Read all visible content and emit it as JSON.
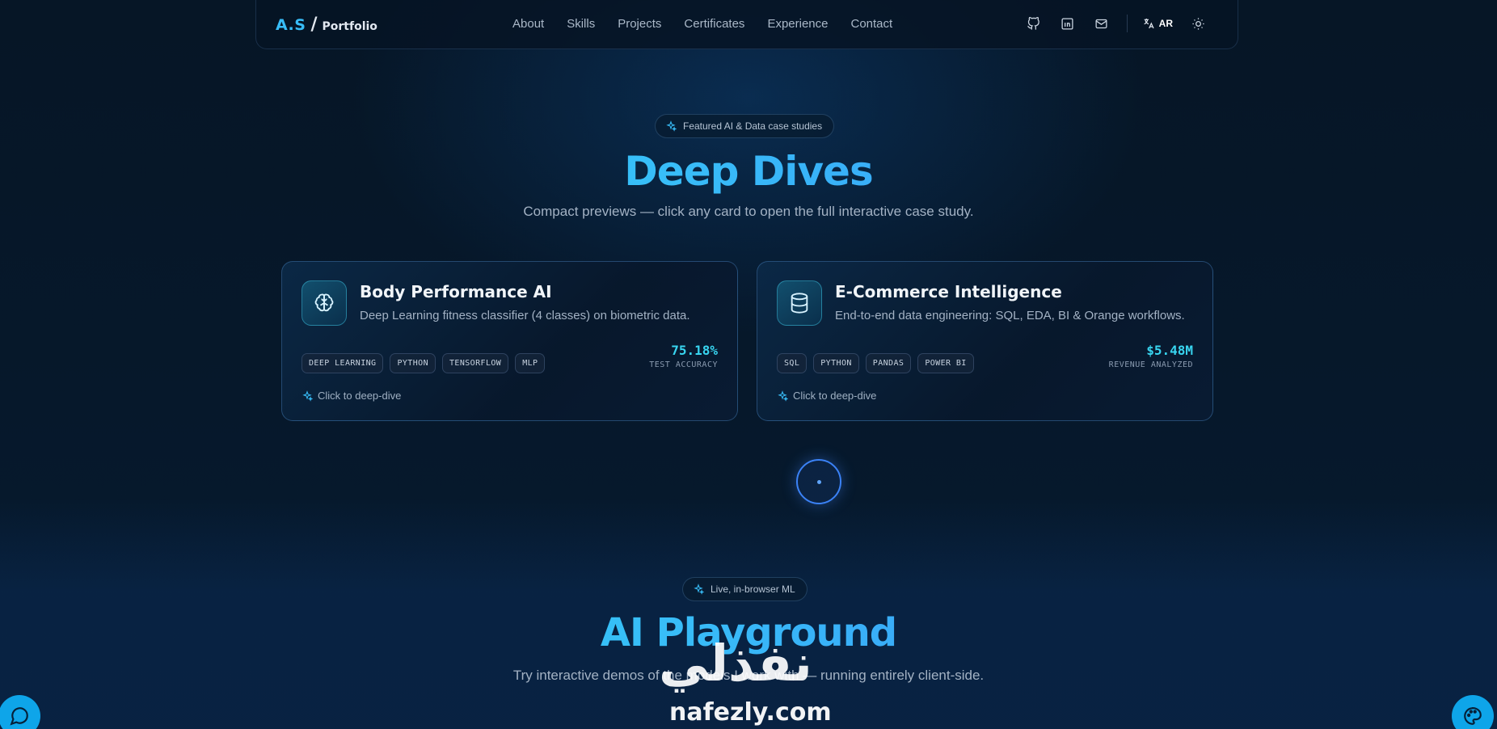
{
  "nav": {
    "logo_initials": "A.S",
    "logo_slash": "/",
    "logo_text": "Portfolio",
    "links": [
      "About",
      "Skills",
      "Projects",
      "Certificates",
      "Experience",
      "Contact"
    ],
    "lang_label": "AR",
    "icons": [
      "github-icon",
      "linkedin-icon",
      "mail-icon",
      "translate-icon",
      "sun-icon"
    ]
  },
  "deep_dives": {
    "badge": "Featured AI & Data case studies",
    "title": "Deep Dives",
    "subtitle": "Compact previews — click any card to open the full interactive case study.",
    "cards": [
      {
        "title": "Body Performance AI",
        "description": "Deep Learning fitness classifier (4 classes) on biometric data.",
        "tags": [
          "DEEP LEARNING",
          "PYTHON",
          "TENSORFLOW",
          "MLP"
        ],
        "metric_value": "75.18%",
        "metric_label": "TEST ACCURACY",
        "cta": "Click to deep-dive",
        "icon": "brain-icon"
      },
      {
        "title": "E-Commerce Intelligence",
        "description": "End-to-end data engineering: SQL, EDA, BI & Orange workflows.",
        "tags": [
          "SQL",
          "PYTHON",
          "PANDAS",
          "POWER BI"
        ],
        "metric_value": "$5.48M",
        "metric_label": "REVENUE ANALYZED",
        "cta": "Click to deep-dive",
        "icon": "database-icon"
      }
    ]
  },
  "playground": {
    "badge": "Live, in-browser ML",
    "title": "AI Playground",
    "subtitle": "Try interactive demos of the models I work with — running entirely client-side."
  },
  "watermark": {
    "arabic": "نفذلي",
    "latin": "nafezly.com"
  },
  "colors": {
    "accent": "#38bdf8",
    "accent_blue": "#3b82f6",
    "background": "#061626"
  }
}
